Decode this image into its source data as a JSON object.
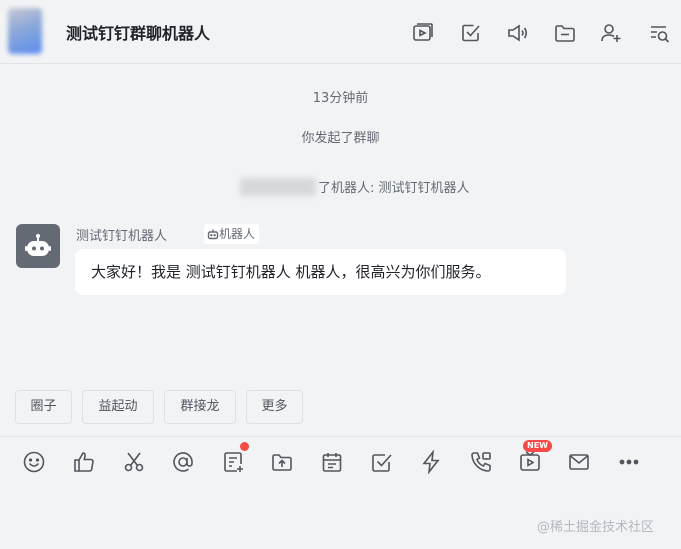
{
  "header": {
    "title": "测试钉钉群聊机器人",
    "icons": [
      "video-icon",
      "task-check-icon",
      "announcement-icon",
      "folder-icon",
      "add-member-icon",
      "search-history-icon"
    ]
  },
  "messages": {
    "time": "13分钟前",
    "group_started": "你发起了群聊",
    "robot_added": "了机器人: 测试钉钉机器人",
    "sender_name": "测试钉钉机器人",
    "sender_tag": "机器人",
    "bubble_text": "大家好！我是 测试钉钉机器人 机器人，很高兴为你们服务。"
  },
  "quick_actions": [
    "圈子",
    "益起动",
    "群接龙",
    "更多"
  ],
  "toolbar": {
    "icons": [
      "emoji-icon",
      "thumbs-up-icon",
      "scissors-icon",
      "mention-icon",
      "form-icon",
      "upload-file-icon",
      "calendar-icon",
      "task-icon",
      "flash-icon",
      "call-icon",
      "live-icon",
      "mail-icon",
      "more-icon"
    ],
    "new_badge": "NEW"
  },
  "watermark": "@稀土掘金技术社区",
  "colors": {
    "background": "#f2f3f5",
    "badge_red": "#f54a45",
    "bubble": "#ffffff",
    "icon": "#51565d"
  }
}
